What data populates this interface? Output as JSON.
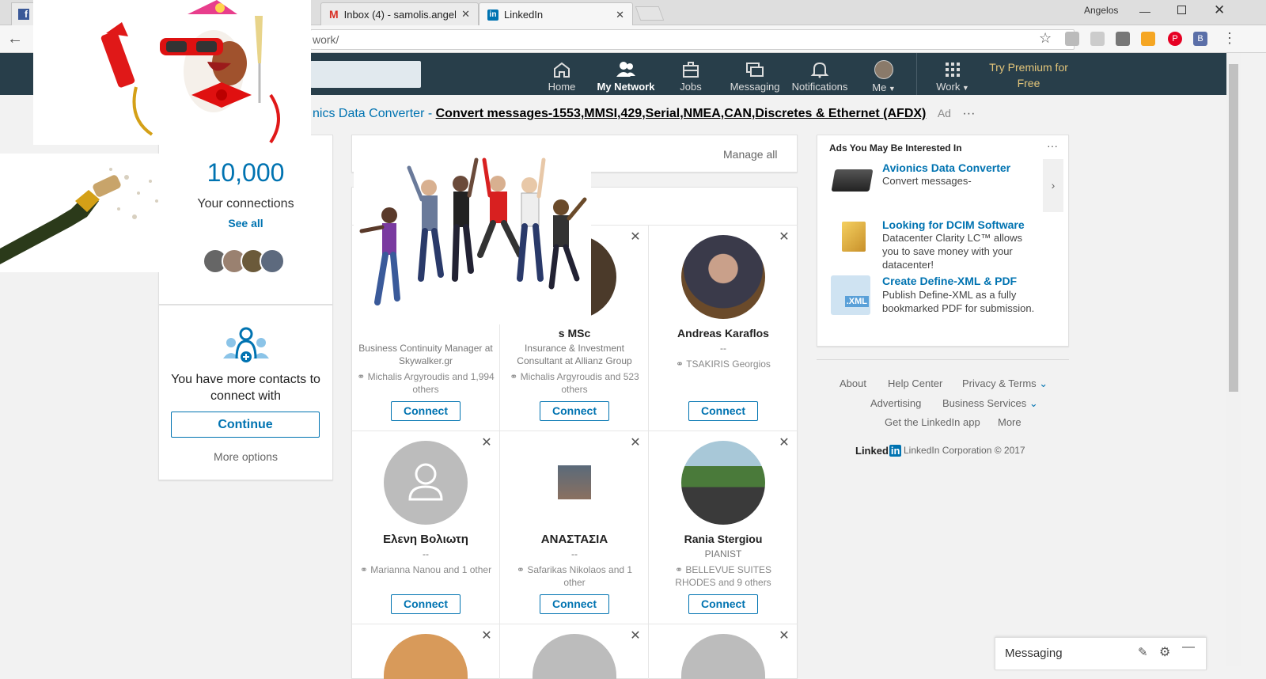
{
  "browser": {
    "tabs": [
      {
        "label": "Inbox (4) - samolis.angel"
      },
      {
        "label": "LinkedIn"
      }
    ],
    "window_user": "Angelos",
    "url": "work/"
  },
  "nav": {
    "home": "Home",
    "network": "My Network",
    "jobs": "Jobs",
    "messaging": "Messaging",
    "notifications": "Notifications",
    "me": "Me",
    "work": "Work",
    "premium": "Try Premium for Free"
  },
  "top_ad": {
    "link": "nics Data Converter -",
    "text": "Convert messages-1553,MMSI,429,Serial,NMEA,CAN,Discretes & Ethernet (AFDX)",
    "tag": "Ad"
  },
  "left": {
    "connections_count": "10,000",
    "connections_label": "Your connections",
    "see_all": "See all",
    "contacts_text": "You have more contacts to connect with",
    "continue": "Continue",
    "more_options": "More options"
  },
  "center": {
    "manage_all": "Manage all",
    "connect_label": "Connect",
    "people": [
      {
        "name": "",
        "headline": "Business Continuity Manager at Skywalker.gr",
        "connections": "Michalis Argyroudis and 1,994 others"
      },
      {
        "name": "s MSc",
        "headline": "Insurance & Investment Consultant at Allianz Group",
        "connections": "Michalis Argyroudis and 523 others"
      },
      {
        "name": "Andreas Karaflos",
        "headline": "--",
        "connections": "TSAKIRIS Georgios"
      },
      {
        "name": "Ελενη Βολιωτη",
        "headline": "--",
        "connections": "Marianna Nanou and 1 other"
      },
      {
        "name": "ΑΝΑΣΤΑΣΙΑ",
        "headline": "--",
        "connections": "Safarikas Nikolaos and 1 other"
      },
      {
        "name": "Rania Stergiou",
        "headline": "PIANIST",
        "connections": "BELLEVUE SUITES RHODES and 9 others"
      }
    ]
  },
  "ads": {
    "title": "Ads You May Be Interested In",
    "items": [
      {
        "title": "Avionics Data Converter",
        "desc": "Convert messages-"
      },
      {
        "title": "Looking for DCIM Software",
        "desc": "Datacenter Clarity LC™ allows you to save money with your datacenter!"
      },
      {
        "title": "Create Define-XML & PDF",
        "desc": "Publish Define-XML as a fully bookmarked PDF for submission."
      }
    ],
    "xml_label": ".XML"
  },
  "footer": {
    "links": [
      "About",
      "Help Center",
      "Privacy & Terms",
      "Advertising",
      "Business Services",
      "Get the LinkedIn app",
      "More"
    ],
    "logo_text": "Linked",
    "logo_in": "in",
    "copyright": "LinkedIn Corporation © 2017"
  },
  "messaging_bar": {
    "label": "Messaging"
  },
  "colors": {
    "linkedin_blue": "#0073b1",
    "header": "#283e4a"
  }
}
